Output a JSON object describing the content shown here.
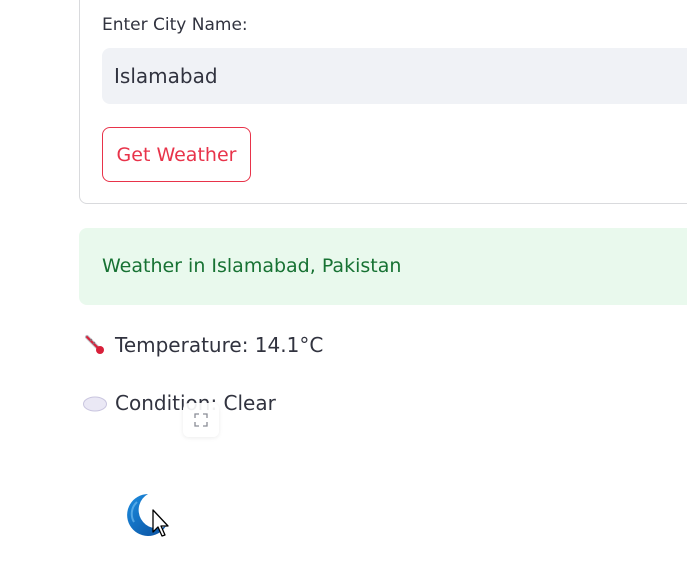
{
  "form": {
    "city_label": "Enter City Name:",
    "city_value": "Islamabad",
    "submit_label": "Get Weather"
  },
  "result": {
    "headline": "Weather in Islamabad, Pakistan",
    "temperature_text": "Temperature: 14.1°C",
    "condition_text": "Condition: Clear"
  },
  "icons": {
    "temperature": "thermometer-icon",
    "condition": "cloud-icon",
    "fullscreen": "expand-icon",
    "weather_image": "crescent-moon-icon"
  },
  "colors": {
    "accent": "#e8334a",
    "success_bg": "#e9f9ed",
    "success_text": "#177233",
    "input_bg": "#f0f2f6"
  }
}
